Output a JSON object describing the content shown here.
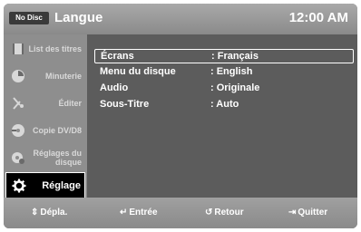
{
  "header": {
    "badge": "No Disc",
    "title": "Langue",
    "clock": "12:00 AM"
  },
  "sidebar": {
    "items": [
      {
        "label": "List des titres",
        "icon": "film-icon",
        "active": false
      },
      {
        "label": "Minuterie",
        "icon": "clock-icon",
        "active": false
      },
      {
        "label": "Éditer",
        "icon": "scissors-icon",
        "active": false
      },
      {
        "label": "Copie DV/D8",
        "icon": "copy-disc-icon",
        "active": false
      },
      {
        "label": "Réglages du disque",
        "icon": "disc-settings-icon",
        "active": false
      },
      {
        "label": "Réglage",
        "icon": "gear-icon",
        "active": true
      }
    ]
  },
  "settings": {
    "rows": [
      {
        "name": "Écrans",
        "value": ": Français"
      },
      {
        "name": "Menu du disque",
        "value": ": English"
      },
      {
        "name": "Audio",
        "value": ": Originale"
      },
      {
        "name": "Sous-Titre",
        "value": ": Auto"
      }
    ]
  },
  "footer": {
    "move": {
      "icon": "updown-arrows-icon",
      "label": "Dépla."
    },
    "enter": {
      "icon": "enter-icon",
      "label": "Entrée"
    },
    "back": {
      "icon": "return-icon",
      "label": "Retour"
    },
    "quit": {
      "icon": "exit-icon",
      "label": "Quitter"
    }
  },
  "colors": {
    "frame": "#5a5a5a",
    "sidebar": "#8e8e8e",
    "active_item": "#000000",
    "text": "#ffffff"
  }
}
